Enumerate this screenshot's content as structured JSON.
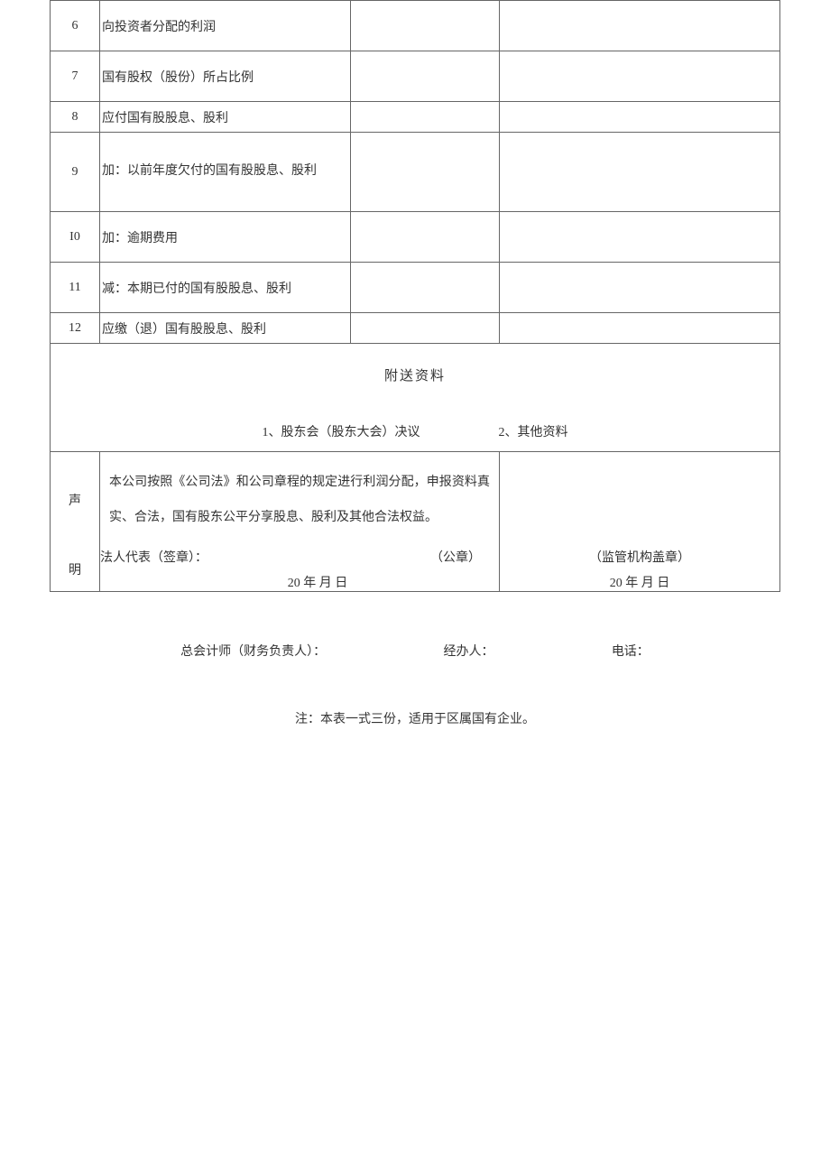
{
  "rows": [
    {
      "idx": "6",
      "label": "向投资者分配的利润",
      "v1": "",
      "v2": ""
    },
    {
      "idx": "7",
      "label": "国有股权（股份）所占比例",
      "v1": "",
      "v2": ""
    },
    {
      "idx": "8",
      "label": "应付国有股股息、股利",
      "v1": "",
      "v2": ""
    },
    {
      "idx": "9",
      "label": "加：以前年度欠付的国有股股息、股利",
      "v1": "",
      "v2": ""
    },
    {
      "idx": "I0",
      "label": "加：逾期费用",
      "v1": "",
      "v2": ""
    },
    {
      "idx": "11",
      "label": "减：本期已付的国有股股息、股利",
      "v1": "",
      "v2": ""
    },
    {
      "idx": "12",
      "label": "应缴（退）国有股股息、股利",
      "v1": "",
      "v2": ""
    }
  ],
  "attach": {
    "header": "附送资料",
    "item1": "1、股东会（股东大会）决议",
    "item2": "2、其他资料"
  },
  "declaration": {
    "side_top": "声",
    "side_bottom": "明",
    "body": "本公司按照《公司法》和公司章程的规定进行利润分配，申报资料真实、合法，国有股东公平分享股息、股利及其他合法权益。",
    "legal_rep_label": "法人代表（签章）：",
    "seal_label": "（公章）",
    "date_left": "20 年 月 日",
    "supervisor_seal": "（监管机构盖章）",
    "date_right": "20 年 月 日"
  },
  "footer": {
    "accountant": "总会计师（财务负责人）：",
    "handler": "经办人：",
    "phone": "电话："
  },
  "note": "注：本表一式三份，适用于区属国有企业。"
}
